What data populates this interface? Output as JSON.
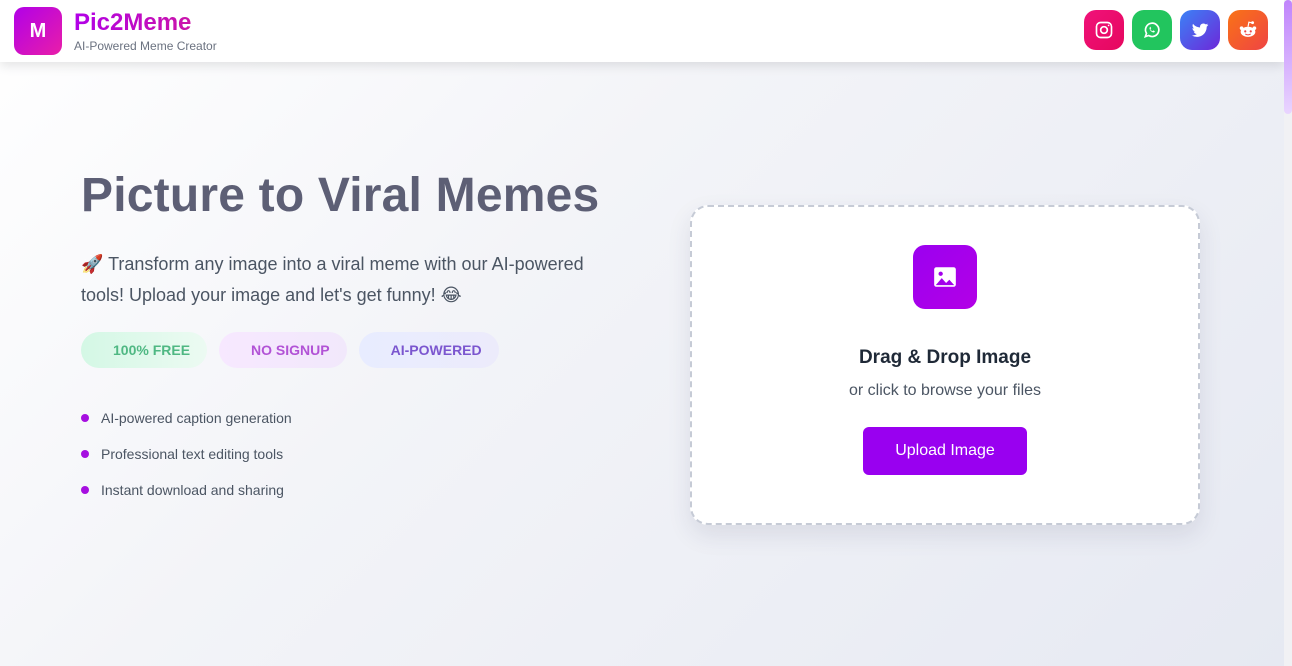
{
  "header": {
    "logo_letter": "M",
    "title": "Pic2Meme",
    "subtitle": "AI-Powered Meme Creator",
    "socials": [
      {
        "name": "instagram-icon",
        "color": "#f0127a"
      },
      {
        "name": "whatsapp-icon",
        "color": "#22c55e"
      },
      {
        "name": "twitter-icon",
        "color": "#4f46e5"
      },
      {
        "name": "reddit-icon",
        "color": "#f4511e"
      }
    ]
  },
  "hero": {
    "title": "Picture to Viral Memes",
    "description": "🚀 Transform any image into a viral meme with our AI-powered tools! Upload your image and let's get funny! 😂",
    "badges": [
      "100% FREE",
      "NO SIGNUP",
      "AI-POWERED"
    ],
    "features": [
      "AI-powered caption generation",
      "Professional text editing tools",
      "Instant download and sharing"
    ]
  },
  "upload": {
    "icon": "image-icon",
    "title": "Drag & Drop Image",
    "subtitle": "or click to browse your files",
    "button_label": "Upload Image"
  },
  "colors": {
    "accent": "#9900f0",
    "title_text": "#5d5f75"
  }
}
